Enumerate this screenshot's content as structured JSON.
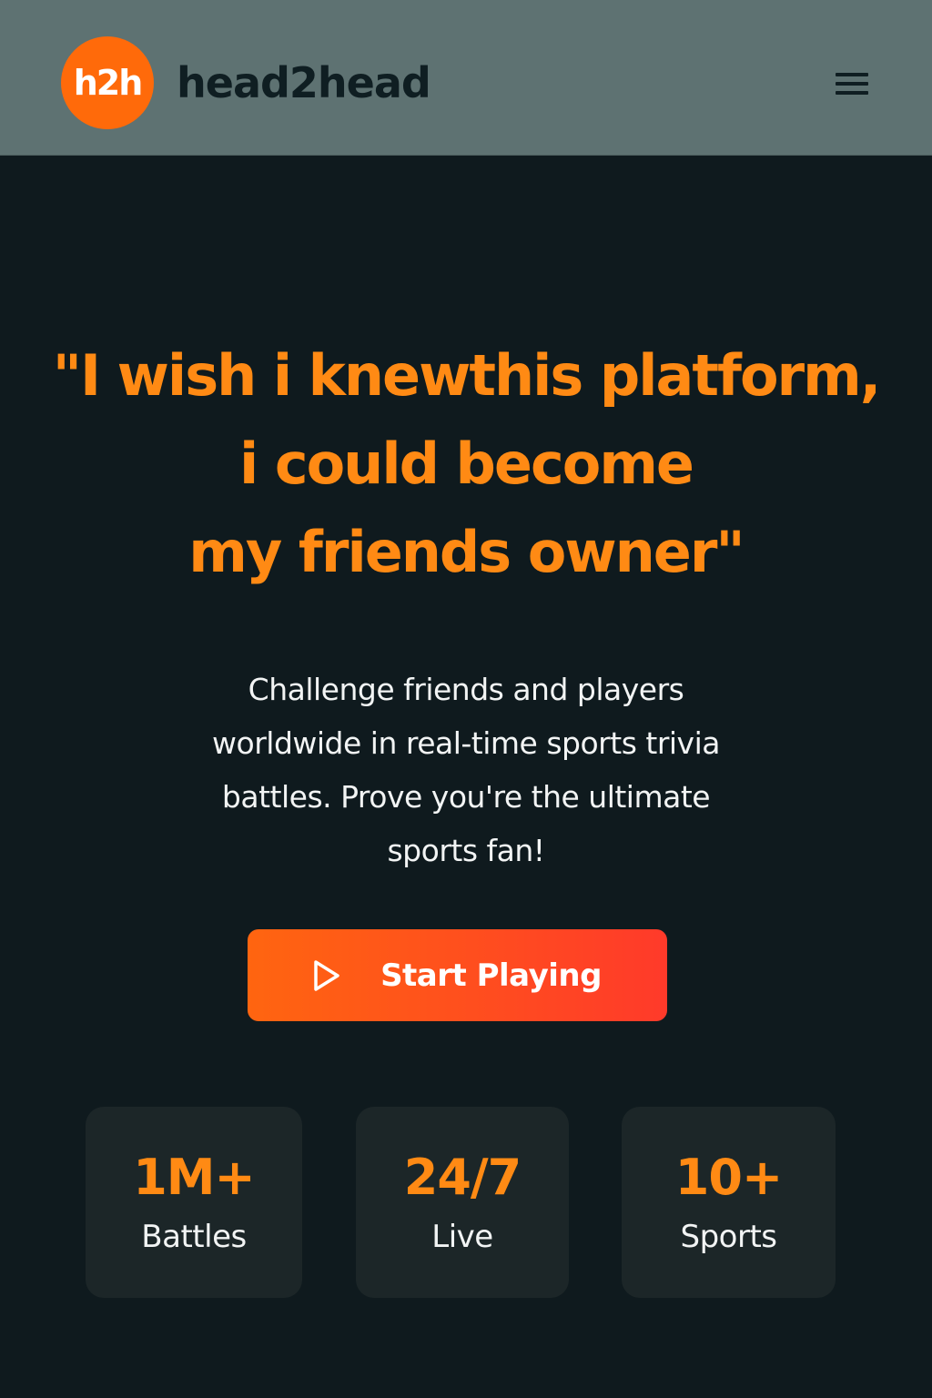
{
  "header": {
    "logo_text": "h2h",
    "brand_name": "head2head",
    "menu_icon": "hamburger-menu-icon"
  },
  "hero": {
    "quote_lines": [
      "\"I wish i knewthis platform,",
      "i could become",
      "my friends owner\""
    ],
    "subtitle_lines": [
      "Challenge friends and players",
      "worldwide in real-time sports trivia",
      "battles. Prove you're the ultimate",
      "sports fan!"
    ]
  },
  "cta": {
    "label": "Start Playing",
    "icon": "play-icon"
  },
  "stats": [
    {
      "value": "1M+",
      "label": "Battles"
    },
    {
      "value": "24/7",
      "label": "Live"
    },
    {
      "value": "10+",
      "label": "Sports"
    }
  ],
  "colors": {
    "header_bg": "#5e7272",
    "page_bg": "#0f1a1e",
    "accent": "#ff8a14",
    "logo_bg": "#ff6a0a",
    "cta_gradient_start": "#ff6510",
    "cta_gradient_end": "#ff3a2a",
    "card_bg": "#1c2628"
  }
}
